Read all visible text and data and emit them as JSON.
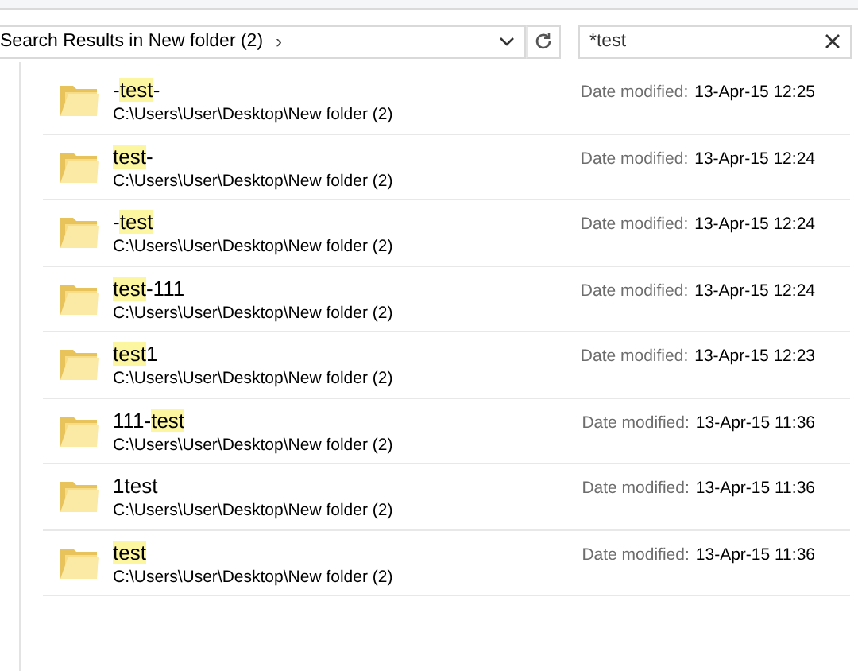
{
  "address_bar": {
    "location": "Search Results in New folder (2)",
    "separator": "›"
  },
  "search": {
    "value": "*test"
  },
  "results": [
    {
      "name": [
        {
          "text": "-",
          "match": false
        },
        {
          "text": "test",
          "match": true
        },
        {
          "text": "-",
          "match": false
        }
      ],
      "path": "C:\\Users\\User\\Desktop\\New folder (2)",
      "date_label": "Date modified:",
      "date": "13-Apr-15 12:25"
    },
    {
      "name": [
        {
          "text": "test",
          "match": true
        },
        {
          "text": "-",
          "match": false
        }
      ],
      "path": "C:\\Users\\User\\Desktop\\New folder (2)",
      "date_label": "Date modified:",
      "date": "13-Apr-15 12:24"
    },
    {
      "name": [
        {
          "text": "-",
          "match": false
        },
        {
          "text": "test",
          "match": true
        }
      ],
      "path": "C:\\Users\\User\\Desktop\\New folder (2)",
      "date_label": "Date modified:",
      "date": "13-Apr-15 12:24"
    },
    {
      "name": [
        {
          "text": "test",
          "match": true
        },
        {
          "text": "-111",
          "match": false
        }
      ],
      "path": "C:\\Users\\User\\Desktop\\New folder (2)",
      "date_label": "Date modified:",
      "date": "13-Apr-15 12:24"
    },
    {
      "name": [
        {
          "text": "test",
          "match": true
        },
        {
          "text": "1",
          "match": false
        }
      ],
      "path": "C:\\Users\\User\\Desktop\\New folder (2)",
      "date_label": "Date modified:",
      "date": "13-Apr-15 12:23"
    },
    {
      "name": [
        {
          "text": "111-",
          "match": false
        },
        {
          "text": "test",
          "match": true
        }
      ],
      "path": "C:\\Users\\User\\Desktop\\New folder (2)",
      "date_label": "Date modified:",
      "date": "13-Apr-15 11:36"
    },
    {
      "name": [
        {
          "text": "1test",
          "match": false
        }
      ],
      "path": "C:\\Users\\User\\Desktop\\New folder (2)",
      "date_label": "Date modified:",
      "date": "13-Apr-15 11:36"
    },
    {
      "name": [
        {
          "text": "test",
          "match": true
        }
      ],
      "path": "C:\\Users\\User\\Desktop\\New folder (2)",
      "date_label": "Date modified:",
      "date": "13-Apr-15 11:36"
    }
  ]
}
